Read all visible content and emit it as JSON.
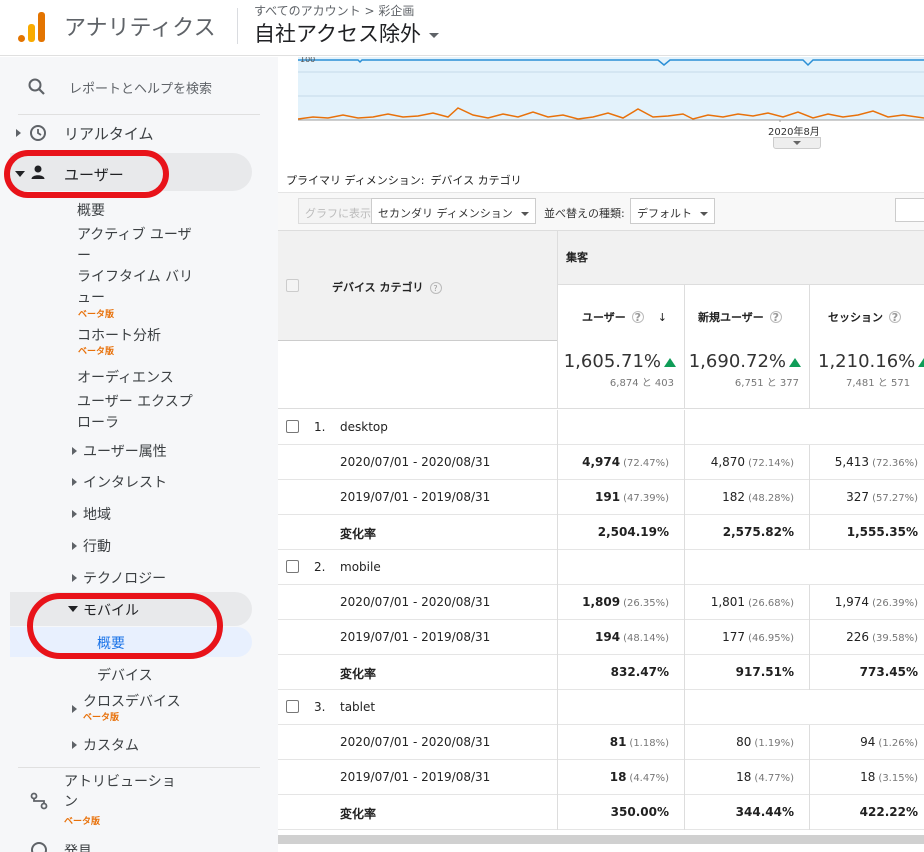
{
  "header": {
    "app_title": "アナリティクス",
    "breadcrumb": "すべてのアカウント > 彩企画",
    "view_name": "自社アクセス除外"
  },
  "sidebar": {
    "search_placeholder": "レポートとヘルプを検索",
    "realtime": "リアルタイム",
    "users": "ユーザー",
    "items": {
      "overview": "概要",
      "active_users_1": "アクティブ ユーザ",
      "active_users_2": "ー",
      "lifetime_1": "ライフタイム バリ",
      "lifetime_2": "ュー",
      "lifetime_beta": "ベータ版",
      "cohort": "コホート分析",
      "cohort_beta": "ベータ版",
      "audience": "オーディエンス",
      "explorer_1": "ユーザー エクスプ",
      "explorer_2": "ローラ",
      "demographics": "ユーザー属性",
      "interests": "インタレスト",
      "geo": "地域",
      "behavior": "行動",
      "technology": "テクノロジー",
      "mobile": "モバイル",
      "mobile_overview": "概要",
      "mobile_devices": "デバイス",
      "cross_device": "クロスデバイス",
      "cross_device_beta": "ベータ版",
      "custom": "カスタム",
      "attribution_1": "アトリビューショ",
      "attribution_2": "ン",
      "attribution_beta": "ベータ版",
      "discover": "発見"
    }
  },
  "chart": {
    "y_tick": "100",
    "x_tick": "2020年8月",
    "line_color": "#e8710a",
    "area_color": "#e3f2fb"
  },
  "table_controls": {
    "primary_dimension_label": "プライマリ ディメンション:",
    "primary_dimension_value": "デバイス カテゴリ",
    "graph_button": "グラフに表示",
    "secondary_dimension": "セカンダリ ディメンション",
    "sort_label": "並べ替えの種類:",
    "sort_value": "デフォルト"
  },
  "table": {
    "dimension_header": "デバイス カテゴリ",
    "group_header": "集客",
    "columns": [
      "ユーザー",
      "新規ユーザー",
      "セッション"
    ],
    "summary": [
      {
        "pct": "1,605.71%",
        "sub": "6,874 と 403"
      },
      {
        "pct": "1,690.72%",
        "sub": "6,751 と 377"
      },
      {
        "pct": "1,210.16%",
        "sub": "7,481 と 571"
      }
    ],
    "groups": [
      {
        "num": "1.",
        "name": "desktop",
        "rows": [
          {
            "label": "2020/07/01 - 2020/08/31",
            "v": [
              [
                "4,974",
                "(72.47%)"
              ],
              [
                "4,870",
                "(72.14%)"
              ],
              [
                "5,413",
                "(72.36%)"
              ]
            ]
          },
          {
            "label": "2019/07/01 - 2019/08/31",
            "v": [
              [
                "191",
                "(47.39%)"
              ],
              [
                "182",
                "(48.28%)"
              ],
              [
                "327",
                "(57.27%)"
              ]
            ]
          },
          {
            "label": "変化率",
            "v": [
              [
                "2,504.19%",
                ""
              ],
              [
                "2,575.82%",
                ""
              ],
              [
                "1,555.35%",
                ""
              ]
            ]
          }
        ]
      },
      {
        "num": "2.",
        "name": "mobile",
        "rows": [
          {
            "label": "2020/07/01 - 2020/08/31",
            "v": [
              [
                "1,809",
                "(26.35%)"
              ],
              [
                "1,801",
                "(26.68%)"
              ],
              [
                "1,974",
                "(26.39%)"
              ]
            ]
          },
          {
            "label": "2019/07/01 - 2019/08/31",
            "v": [
              [
                "194",
                "(48.14%)"
              ],
              [
                "177",
                "(46.95%)"
              ],
              [
                "226",
                "(39.58%)"
              ]
            ]
          },
          {
            "label": "変化率",
            "v": [
              [
                "832.47%",
                ""
              ],
              [
                "917.51%",
                ""
              ],
              [
                "773.45%",
                ""
              ]
            ]
          }
        ]
      },
      {
        "num": "3.",
        "name": "tablet",
        "rows": [
          {
            "label": "2020/07/01 - 2020/08/31",
            "v": [
              [
                "81",
                "(1.18%)"
              ],
              [
                "80",
                "(1.19%)"
              ],
              [
                "94",
                "(1.26%)"
              ]
            ]
          },
          {
            "label": "2019/07/01 - 2019/08/31",
            "v": [
              [
                "18",
                "(4.47%)"
              ],
              [
                "18",
                "(4.77%)"
              ],
              [
                "18",
                "(3.15%)"
              ]
            ]
          },
          {
            "label": "変化率",
            "v": [
              [
                "350.00%",
                ""
              ],
              [
                "344.44%",
                ""
              ],
              [
                "422.22%",
                ""
              ]
            ]
          }
        ]
      }
    ]
  },
  "annotation_color": "#e8131a"
}
